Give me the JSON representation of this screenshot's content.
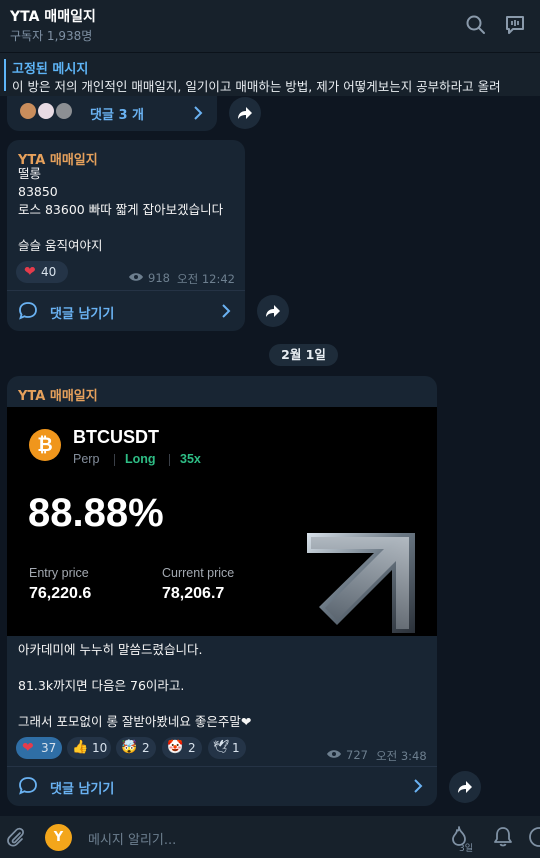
{
  "header": {
    "title": "YTA 매매일지",
    "subscribers": "구독자 1,938명"
  },
  "pinned": {
    "title": "고정된 메시지",
    "text": "이 방은 저의 개인적인 매매일지, 일기이고 매매하는 방법, 제가 어떻게보는지 공부하라고 올려"
  },
  "top_partial": {
    "comments_label": "댓글 3 개"
  },
  "message1": {
    "author": "YTA 매매일지",
    "text": "떨롱\n83850\n로스 83600 빠따 짧게 잡아보겠습니다\n\n슬슬 움직여야지",
    "reaction": {
      "emoji": "❤",
      "count": "40"
    },
    "views": "918",
    "time": "오전 12:42",
    "comment_label": "댓글 남기기"
  },
  "date_badge": "2월 1일",
  "message2": {
    "author": "YTA 매매일지",
    "card": {
      "coin_symbol": "₿",
      "pair": "BTCUSDT",
      "perp": "Perp",
      "side": "Long",
      "leverage": "35x",
      "pnl": "88.88%",
      "entry_label": "Entry price",
      "entry_value": "76,220.6",
      "current_label": "Current price",
      "current_value": "78,206.7"
    },
    "text": "아카데미에 누누히 말씀드렸습니다.\n\n81.3k까지면 다음은 76이라고.\n\n그래서 포모없이 롱 잘받아봤네요 좋은주말❤",
    "reactions": [
      {
        "emoji": "❤",
        "count": "37"
      },
      {
        "emoji": "👍",
        "count": "10"
      },
      {
        "emoji": "🤯",
        "count": "2"
      },
      {
        "emoji": "🤡",
        "count": "2"
      },
      {
        "emoji": "🕊",
        "count": "1"
      }
    ],
    "views": "727",
    "time": "오전 3:48",
    "comment_label": "댓글 남기기"
  },
  "input": {
    "placeholder": "메시지 알리기...",
    "boost_count": "3일"
  },
  "colors": {
    "background": "#0e1621",
    "bubble": "#182533",
    "accent": "#5eb5f7",
    "author": "#e6a15c",
    "long_green": "#2ebd85",
    "btc_orange": "#f0961c"
  }
}
